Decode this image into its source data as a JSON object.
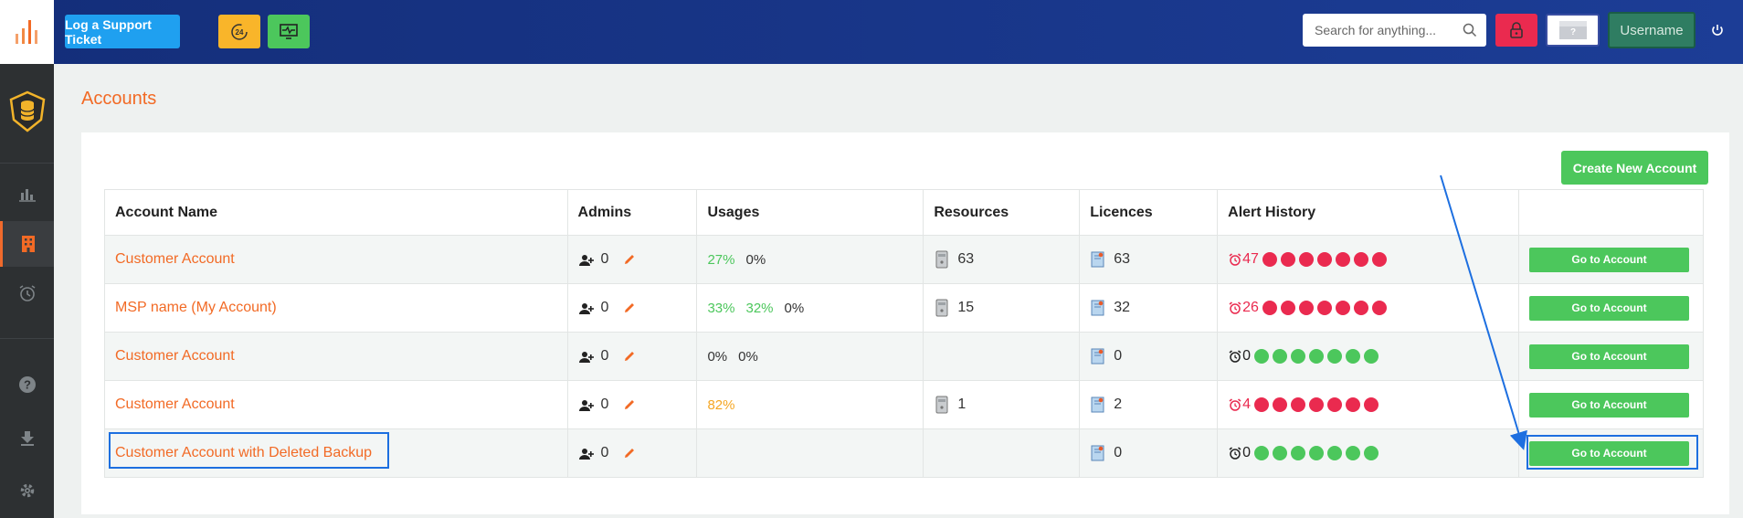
{
  "header": {
    "support_label": "Log a Support Ticket",
    "search_placeholder": "Search for anything...",
    "username": "Username"
  },
  "page": {
    "title": "Accounts",
    "create_label": "Create New Account"
  },
  "table": {
    "columns": [
      "Account Name",
      "Admins",
      "Usages",
      "Resources",
      "Licences",
      "Alert History"
    ],
    "rows": [
      {
        "name": "Customer Account",
        "admins": "0",
        "usages": [
          {
            "v": "27%",
            "c": "green"
          },
          {
            "v": "0%",
            "c": "dark"
          }
        ],
        "resources": "63",
        "licences": "63",
        "alert_count": "47",
        "alert_color": "red",
        "dots": "red",
        "action": "Go to Account"
      },
      {
        "name": "MSP name (My Account)",
        "admins": "0",
        "usages": [
          {
            "v": "33%",
            "c": "green"
          },
          {
            "v": "32%",
            "c": "green"
          },
          {
            "v": "0%",
            "c": "dark"
          }
        ],
        "resources": "15",
        "licences": "32",
        "alert_count": "26",
        "alert_color": "red",
        "dots": "red",
        "action": "Go to Account"
      },
      {
        "name": "Customer Account",
        "admins": "0",
        "usages": [
          {
            "v": "0%",
            "c": "dark"
          },
          {
            "v": "0%",
            "c": "dark"
          }
        ],
        "resources": "",
        "licences": "0",
        "alert_count": "0",
        "alert_color": "dark",
        "dots": "green",
        "action": "Go to Account"
      },
      {
        "name": "Customer Account",
        "admins": "0",
        "usages": [
          {
            "v": "82%",
            "c": "orange"
          }
        ],
        "resources": "1",
        "licences": "2",
        "alert_count": "4",
        "alert_color": "red",
        "dots": "red",
        "action": "Go to Account"
      },
      {
        "name": "Customer Account with Deleted Backup",
        "admins": "0",
        "usages": [],
        "resources": "",
        "licences": "0",
        "alert_count": "0",
        "alert_color": "dark",
        "dots": "green",
        "action": "Go to Account"
      }
    ]
  },
  "colors": {
    "accent": "#f26a25",
    "success": "#4cc75c",
    "danger": "#ea2a4f",
    "header_blue": "#1c3d96",
    "annotation_blue": "#1d6fe0"
  },
  "icons": [
    "logo-bars-icon",
    "support-24-icon",
    "monitor-icon",
    "search-icon",
    "lock-icon",
    "flag-icon",
    "power-icon",
    "shield-database-icon",
    "chart-icon",
    "building-icon",
    "alarm-icon",
    "help-icon",
    "download-icon",
    "gear-icon",
    "add-user-icon",
    "pencil-icon",
    "server-icon",
    "license-icon",
    "alarm-clock-icon"
  ]
}
